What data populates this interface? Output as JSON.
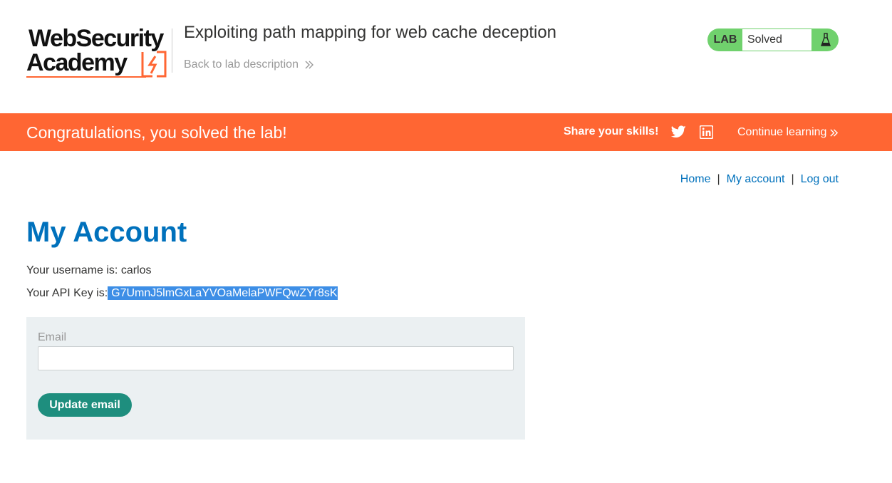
{
  "logo": {
    "line1": "WebSecurity",
    "line2": "Academy"
  },
  "lab": {
    "title": "Exploiting path mapping for web cache deception",
    "back_link": "Back to lab description",
    "status_label": "LAB",
    "status_value": "Solved",
    "status_color": "#70d16d"
  },
  "banner": {
    "message": "Congratulations, you solved the lab!",
    "share": "Share your skills!",
    "continue": "Continue learning",
    "color": "#ff6633"
  },
  "nav": {
    "home": "Home",
    "sep1": "|",
    "my_account": "My account",
    "sep2": "|",
    "log_out": "Log out"
  },
  "account": {
    "title": "My Account",
    "username_text": "Your username is: carlos",
    "apikey_prefix": "Your API Key is:",
    "apikey_value": "G7UmnJ5lmGxLaYVOaMelaPWFQwZYr8sK"
  },
  "form": {
    "email_label": "Email",
    "email_value": "",
    "submit_label": "Update email"
  }
}
